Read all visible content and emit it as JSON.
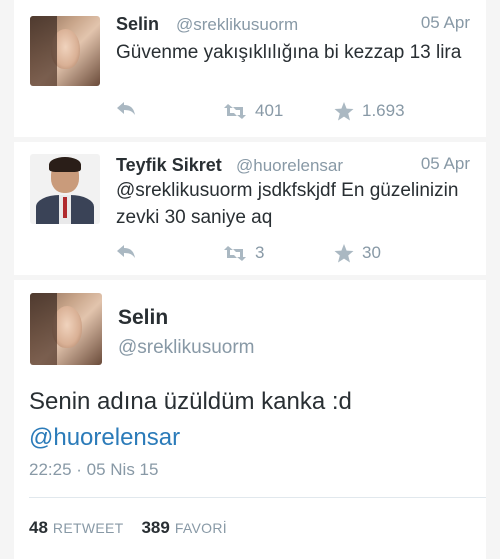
{
  "tweets": [
    {
      "name": "Selin",
      "handle": "@sreklikusuorm",
      "date": "05 Apr",
      "text": "Güvenme yakışıklılığına bi kezzap 13 lira",
      "retweets": "401",
      "favorites": "1.693"
    },
    {
      "name": "Teyfik Sikret",
      "handle": "@huorelensar",
      "date": "05 Apr",
      "text": "@sreklikusuorm jsdkfskjdf En güzelinizin zevki 30 saniye aq",
      "retweets": "3",
      "favorites": "30"
    }
  ],
  "detail": {
    "name": "Selin",
    "handle": "@sreklikusuorm",
    "text": "Senin adına üzüldüm kanka :d",
    "mention": "@huorelensar",
    "timestamp": "22:25 · 05 Nis 15",
    "retweet_count": "48",
    "retweet_label": "RETWEET",
    "favorite_count": "389",
    "favorite_label": "FAVORİ"
  },
  "colors": {
    "text": "#292f33",
    "muted": "#8899a6",
    "link": "#2b7bb9",
    "icon": "#aab8c2"
  },
  "icons": [
    "reply-icon",
    "retweet-icon",
    "favorite-star-icon"
  ]
}
